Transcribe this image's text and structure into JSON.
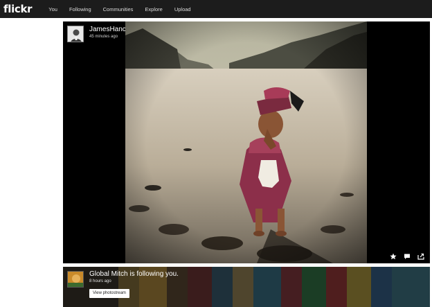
{
  "nav": {
    "logo": "flickr",
    "items": [
      "You",
      "Following",
      "Communities",
      "Explore",
      "Upload"
    ]
  },
  "post": {
    "owner": "JamesHancox",
    "time": "45 minutes ago"
  },
  "actions": [
    "star-icon",
    "comment-icon",
    "share-icon"
  ],
  "notification": {
    "title": "Global Mitch is following you.",
    "time": "8 hours ago",
    "button": "View photostream"
  }
}
